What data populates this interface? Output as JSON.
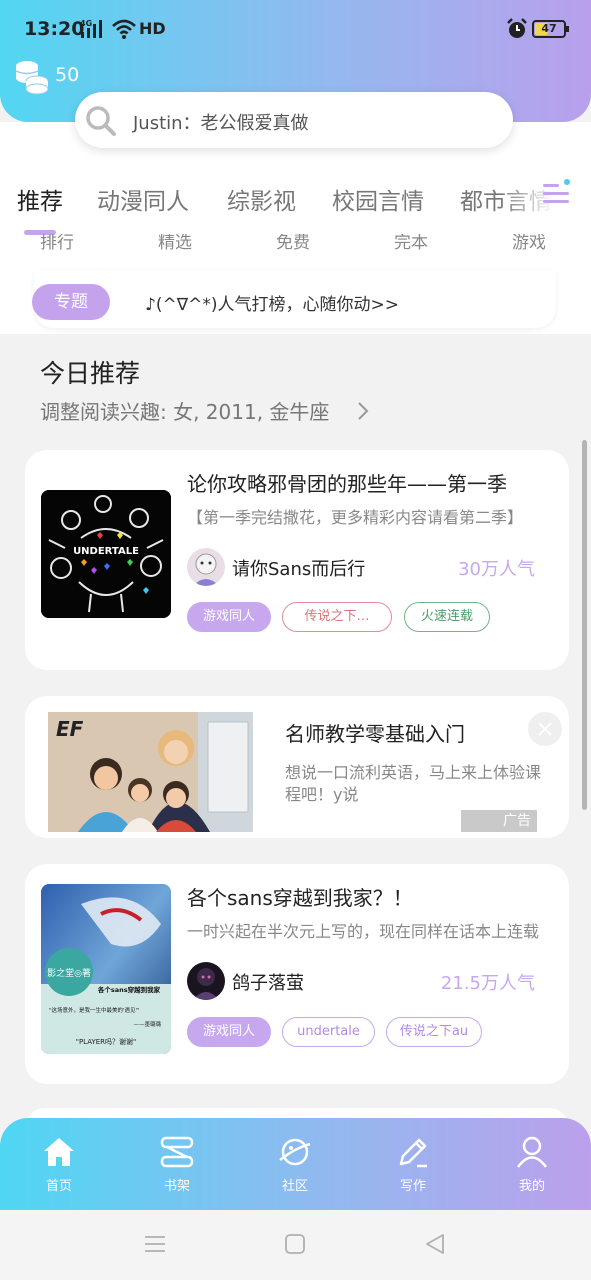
{
  "status_bar": {
    "time": "13:20",
    "network": "4G",
    "hd": "HD",
    "battery": "47",
    "battery_level": 0.47
  },
  "header": {
    "coins_count": "50",
    "search": {
      "text": "Justin：老公假爱真做"
    }
  },
  "category_tabs": [
    {
      "label": "推荐",
      "active": true
    },
    {
      "label": "动漫同人",
      "active": false
    },
    {
      "label": "综影视",
      "active": false
    },
    {
      "label": "校园言情",
      "active": false
    },
    {
      "label": "都市言情",
      "active": false
    }
  ],
  "sub_tabs": [
    "排行",
    "精选",
    "免费",
    "完本",
    "游戏"
  ],
  "topic": {
    "badge": "专题",
    "text": "♪(^∇^*)人气打榜，心随你动>>"
  },
  "today": {
    "title": "今日推荐",
    "subtitle": "调整阅读兴趣: 女, 2011, 金牛座"
  },
  "books": [
    {
      "title": "论你攻略邪骨团的那些年——第一季",
      "description": "【第一季完结撒花，更多精彩内容请看第二季】",
      "cover_text": "UNDERTALE",
      "author": "请你Sans而后行",
      "popularity": "30万人气",
      "tags": [
        {
          "label": "游戏同人",
          "style": "filled"
        },
        {
          "label": "传说之下…",
          "style": "red"
        },
        {
          "label": "火速连载",
          "style": "green"
        }
      ]
    },
    {
      "title": "各个sans穿越到我家？！",
      "description": "一时兴起在半次元上写的，现在同样在话本上连载",
      "cover_lines": [
        "影之堂◎著",
        "各个sans穿越到我家",
        "\"这场意外，是我一生中最美的'遇见'\"",
        "——墨璐璐",
        "\"PLAYER吗？谢谢\""
      ],
      "author": "鸽子落萤",
      "popularity": "21.5万人气",
      "tags": [
        {
          "label": "游戏同人",
          "style": "filled"
        },
        {
          "label": "undertale",
          "style": "purple"
        },
        {
          "label": "传说之下au",
          "style": "purple"
        }
      ]
    }
  ],
  "ad": {
    "title": "名师教学零基础入门",
    "description": "想说一口流利英语，马上来上体验课程吧！y说",
    "logo_text": "EF",
    "label": "广告"
  },
  "bottom_nav": [
    {
      "label": "首页",
      "icon": "home-icon"
    },
    {
      "label": "书架",
      "icon": "bookshelf-icon"
    },
    {
      "label": "社区",
      "icon": "community-planet-icon"
    },
    {
      "label": "写作",
      "icon": "pen-icon"
    },
    {
      "label": "我的",
      "icon": "profile-icon"
    }
  ],
  "colors": {
    "accent": "#c5a3ec",
    "header_start": "#52d6f2",
    "header_end": "#b9a0ec",
    "popularity": "#c6a8ee"
  }
}
